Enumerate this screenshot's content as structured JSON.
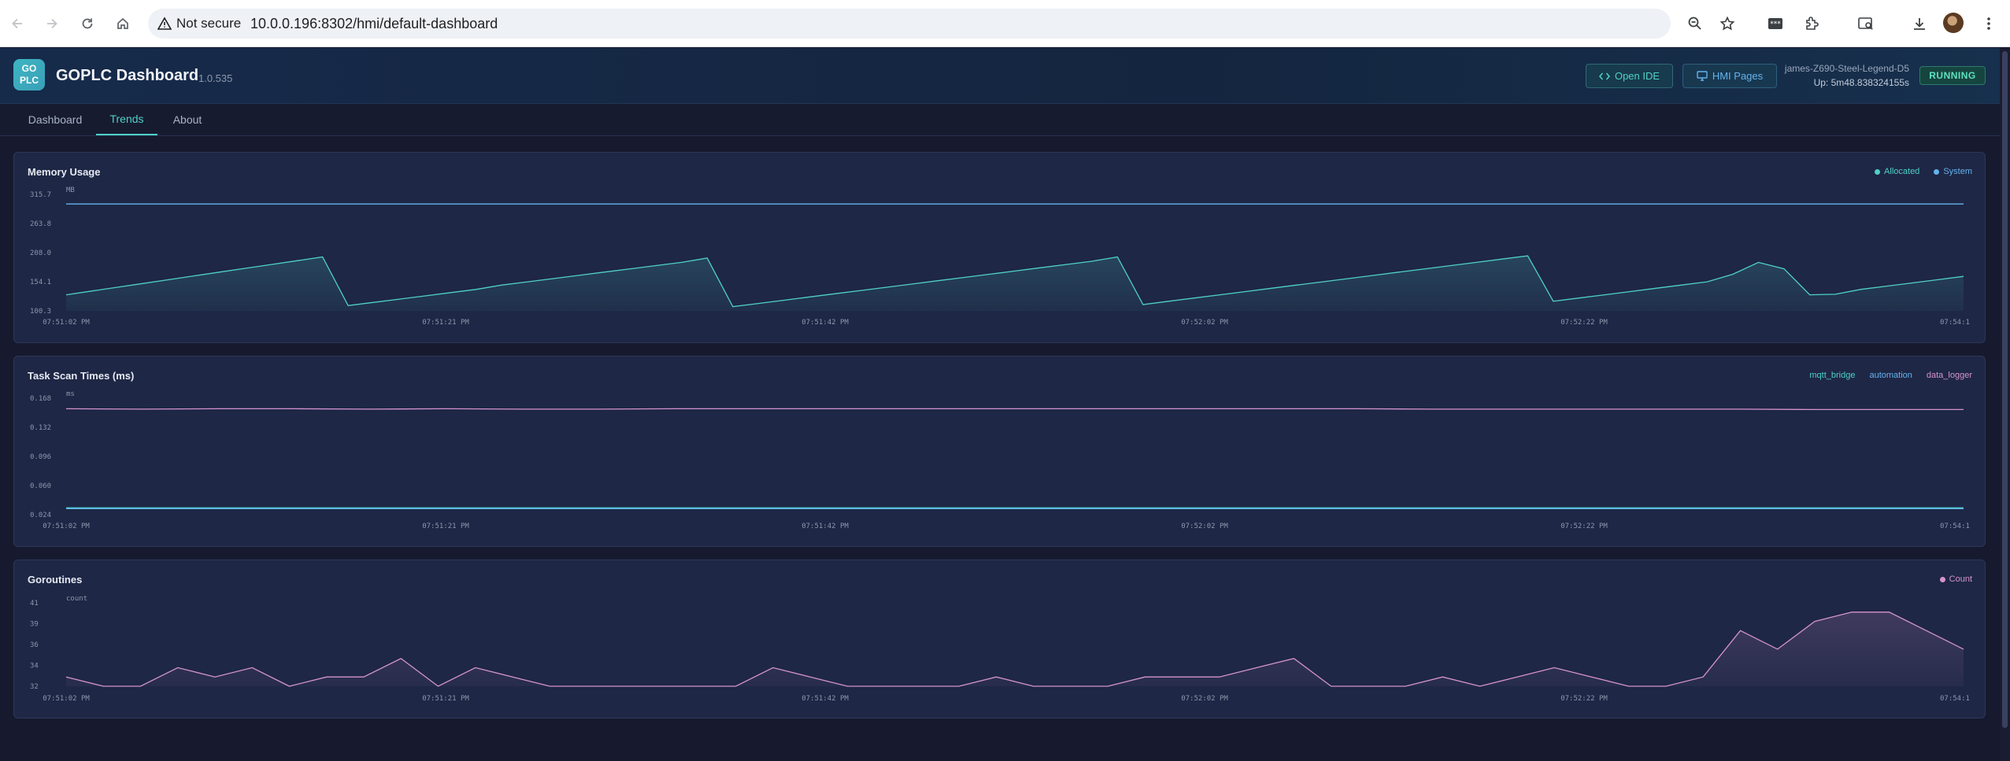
{
  "browser": {
    "security_label": "Not secure",
    "url": "10.0.0.196:8302/hmi/default-dashboard"
  },
  "app": {
    "logo_line1": "GO",
    "logo_line2": "PLC",
    "title": "GOPLC Dashboard",
    "version": "1.0.535",
    "open_ide_label": "Open IDE",
    "hmi_pages_label": "HMI Pages",
    "host": "james-Z690-Steel-Legend-D5",
    "uptime": "Up: 5m48.838324155s",
    "status": "RUNNING"
  },
  "tabs": [
    {
      "label": "Dashboard",
      "active": false
    },
    {
      "label": "Trends",
      "active": true
    },
    {
      "label": "About",
      "active": false
    }
  ],
  "colors": {
    "teal": "#4fd1c5",
    "blue": "#63b3ed",
    "pink": "#d593d1"
  },
  "chart_data": [
    {
      "id": "memory",
      "type": "area",
      "title": "Memory Usage",
      "ylabel": "MB",
      "ylim": [
        100.3,
        315.7
      ],
      "yticks": [
        "315.7",
        "263.8",
        "208.0",
        "154.1",
        "100.3"
      ],
      "xticks": [
        "07:51:02 PM",
        "07:51:21 PM",
        "07:51:42 PM",
        "07:52:02 PM",
        "07:52:22 PM",
        "07:54:1"
      ],
      "series": [
        {
          "name": "Allocated",
          "color": "#4fd1c5",
          "fill": true,
          "values": [
            130,
            137,
            144,
            151,
            158,
            165,
            172,
            179,
            186,
            193,
            200,
            110,
            116,
            122,
            128,
            134,
            140,
            148,
            154,
            160,
            166,
            172,
            178,
            184,
            190,
            198,
            108,
            114,
            120,
            126,
            132,
            138,
            144,
            150,
            156,
            162,
            168,
            174,
            180,
            186,
            192,
            200,
            112,
            118,
            124,
            130,
            136,
            142,
            148,
            154,
            160,
            166,
            172,
            178,
            184,
            190,
            196,
            202,
            118,
            124,
            130,
            136,
            142,
            148,
            154,
            168,
            190,
            178,
            130,
            131,
            140,
            146,
            152,
            158,
            164
          ]
        },
        {
          "name": "System",
          "color": "#63b3ed",
          "fill": false,
          "values": [
            298,
            298,
            298,
            298,
            298,
            298,
            298,
            298,
            298,
            298,
            298,
            298,
            298,
            298,
            298,
            298,
            298,
            298,
            298,
            298,
            298,
            298,
            298,
            298,
            298,
            298,
            298,
            298,
            298,
            298,
            298,
            298,
            298,
            298,
            298,
            298,
            298,
            298,
            298,
            298,
            298,
            298,
            298,
            298,
            298,
            298,
            298,
            298,
            298,
            298,
            298,
            298,
            298,
            298,
            298,
            298,
            298,
            298,
            298,
            298,
            298,
            298,
            298,
            298,
            298,
            298,
            298,
            298,
            298,
            298,
            298,
            298,
            298,
            298,
            298
          ]
        }
      ]
    },
    {
      "id": "scan",
      "type": "line",
      "title": "Task Scan Times (ms)",
      "ylabel": "ms",
      "ylim": [
        0.024,
        0.168
      ],
      "yticks": [
        "0.168",
        "0.132",
        "0.096",
        "0.060",
        "0.024"
      ],
      "xticks": [
        "07:51:02 PM",
        "07:51:21 PM",
        "07:51:42 PM",
        "07:52:02 PM",
        "07:52:22 PM",
        "07:54:1"
      ],
      "series": [
        {
          "name": "mqtt_bridge",
          "color": "#4fd1c5",
          "fill": false,
          "values": [
            0.0325,
            0.0325,
            0.0325,
            0.0325,
            0.0325,
            0.0325,
            0.0325,
            0.0325,
            0.0325,
            0.0325,
            0.0325,
            0.0325,
            0.0325,
            0.0325,
            0.0325,
            0.0325,
            0.0325,
            0.0325,
            0.0325,
            0.0325,
            0.0325,
            0.0325,
            0.0325,
            0.0325,
            0.0325,
            0.0325
          ]
        },
        {
          "name": "automation",
          "color": "#63b3ed",
          "fill": false,
          "values": [
            0.0315,
            0.0315,
            0.0315,
            0.0315,
            0.0315,
            0.0315,
            0.0315,
            0.0315,
            0.0315,
            0.0315,
            0.0315,
            0.0315,
            0.0315,
            0.0315,
            0.0315,
            0.0315,
            0.0315,
            0.0315,
            0.0315,
            0.0315,
            0.0315,
            0.0315,
            0.0315,
            0.0315,
            0.0315,
            0.0315
          ]
        },
        {
          "name": "data_logger",
          "color": "#d593d1",
          "fill": false,
          "values": [
            0.155,
            0.1545,
            0.155,
            0.155,
            0.1545,
            0.155,
            0.1545,
            0.1545,
            0.155,
            0.155,
            0.155,
            0.155,
            0.155,
            0.155,
            0.155,
            0.155,
            0.155,
            0.155,
            0.1545,
            0.1545,
            0.1545,
            0.1545,
            0.1545,
            0.154,
            0.154,
            0.154
          ]
        }
      ]
    },
    {
      "id": "goroutines",
      "type": "area",
      "title": "Goroutines",
      "ylabel": "count",
      "ylim": [
        32,
        41
      ],
      "yticks": [
        "41",
        "39",
        "36",
        "34",
        "32"
      ],
      "xticks": [
        "07:51:02 PM",
        "07:51:21 PM",
        "07:51:42 PM",
        "07:52:02 PM",
        "07:52:22 PM",
        "07:54:1"
      ],
      "series": [
        {
          "name": "Count",
          "color": "#d593d1",
          "fill": true,
          "values": [
            33,
            32,
            32,
            34,
            33,
            34,
            32,
            33,
            33,
            35,
            32,
            34,
            33,
            32,
            32,
            32,
            32,
            32,
            32,
            34,
            33,
            32,
            32,
            32,
            32,
            33,
            32,
            32,
            32,
            33,
            33,
            33,
            34,
            35,
            32,
            32,
            32,
            33,
            32,
            33,
            34,
            33,
            32,
            32,
            33,
            38,
            36,
            39,
            40,
            40,
            38,
            36
          ]
        }
      ]
    }
  ]
}
